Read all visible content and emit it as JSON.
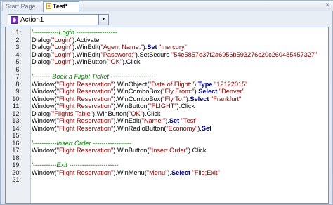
{
  "tabs": [
    {
      "label": "Start Page",
      "active": false
    },
    {
      "label": "Test*",
      "active": true
    }
  ],
  "close_glyph": "×",
  "action_selector": {
    "value": "Action1"
  },
  "editor": {
    "lines": [
      {
        "n": "1:",
        "parts": [
          {
            "t": "'------------Login -------------------",
            "c": "cm"
          }
        ]
      },
      {
        "n": "2:",
        "parts": [
          {
            "t": "Dialog(",
            "c": "pc"
          },
          {
            "t": "\"Login\"",
            "c": "st"
          },
          {
            "t": ").Activate",
            "c": "pc"
          }
        ]
      },
      {
        "n": "3:",
        "parts": [
          {
            "t": "Dialog(",
            "c": "pc"
          },
          {
            "t": "\"Login\"",
            "c": "st"
          },
          {
            "t": ").WinEdit(",
            "c": "pc"
          },
          {
            "t": "\"Agent Name:\"",
            "c": "st"
          },
          {
            "t": ").",
            "c": "pc"
          },
          {
            "t": "Set",
            "c": "kw"
          },
          {
            "t": " ",
            "c": "pc"
          },
          {
            "t": "\"mercury\"",
            "c": "st"
          }
        ]
      },
      {
        "n": "4:",
        "parts": [
          {
            "t": "Dialog(",
            "c": "pc"
          },
          {
            "t": "\"Login\"",
            "c": "st"
          },
          {
            "t": ").WinEdit(",
            "c": "pc"
          },
          {
            "t": "\"Password:\"",
            "c": "st"
          },
          {
            "t": ").SetSecure ",
            "c": "pc"
          },
          {
            "t": "\"54e5857e37f2a6956b593276c20c260485457327\"",
            "c": "st"
          }
        ]
      },
      {
        "n": "5:",
        "parts": [
          {
            "t": "Dialog(",
            "c": "pc"
          },
          {
            "t": "\"Login\"",
            "c": "st"
          },
          {
            "t": ").WinButton(",
            "c": "pc"
          },
          {
            "t": "\"OK\"",
            "c": "st"
          },
          {
            "t": ").Click",
            "c": "pc"
          }
        ]
      },
      {
        "n": "6:",
        "parts": []
      },
      {
        "n": "7:",
        "parts": [
          {
            "t": "'---------Book a Flight Ticket ---------------------",
            "c": "cm"
          }
        ]
      },
      {
        "n": "8:",
        "parts": [
          {
            "t": "Window(",
            "c": "pc"
          },
          {
            "t": "\"Flight Reservation\"",
            "c": "st"
          },
          {
            "t": ").WinObject(",
            "c": "pc"
          },
          {
            "t": "\"Date of Flight:\"",
            "c": "st"
          },
          {
            "t": ").",
            "c": "pc"
          },
          {
            "t": "Type",
            "c": "kw"
          },
          {
            "t": " ",
            "c": "pc"
          },
          {
            "t": "\"12122015\"",
            "c": "st"
          }
        ]
      },
      {
        "n": "9:",
        "parts": [
          {
            "t": "Window(",
            "c": "pc"
          },
          {
            "t": "\"Flight Reservation\"",
            "c": "st"
          },
          {
            "t": ").WinComboBox(",
            "c": "pc"
          },
          {
            "t": "\"Fly From:\"",
            "c": "st"
          },
          {
            "t": ").",
            "c": "pc"
          },
          {
            "t": "Select",
            "c": "kw"
          },
          {
            "t": " ",
            "c": "pc"
          },
          {
            "t": "\"Denver\"",
            "c": "st"
          }
        ]
      },
      {
        "n": "10:",
        "parts": [
          {
            "t": "Window(",
            "c": "pc"
          },
          {
            "t": "\"Flight Reservation\"",
            "c": "st"
          },
          {
            "t": ").WinComboBox(",
            "c": "pc"
          },
          {
            "t": "\"Fly To:\"",
            "c": "st"
          },
          {
            "t": ").",
            "c": "pc"
          },
          {
            "t": "Select",
            "c": "kw"
          },
          {
            "t": " ",
            "c": "pc"
          },
          {
            "t": "\"Frankfurt\"",
            "c": "st"
          }
        ]
      },
      {
        "n": "11:",
        "parts": [
          {
            "t": "Window(",
            "c": "pc"
          },
          {
            "t": "\"Flight Reservation\"",
            "c": "st"
          },
          {
            "t": ").WinButton(",
            "c": "pc"
          },
          {
            "t": "\"FLIGHT\"",
            "c": "st"
          },
          {
            "t": ").Click",
            "c": "pc"
          }
        ]
      },
      {
        "n": "12:",
        "parts": [
          {
            "t": "Dialog(",
            "c": "pc"
          },
          {
            "t": "\"Flights Table\"",
            "c": "st"
          },
          {
            "t": ").WinButton(",
            "c": "pc"
          },
          {
            "t": "\"OK\"",
            "c": "st"
          },
          {
            "t": ").Click",
            "c": "pc"
          }
        ]
      },
      {
        "n": "13:",
        "parts": [
          {
            "t": "Window(",
            "c": "pc"
          },
          {
            "t": "\"Flight Reservation\"",
            "c": "st"
          },
          {
            "t": ").WinEdit(",
            "c": "pc"
          },
          {
            "t": "\"Name:\"",
            "c": "st"
          },
          {
            "t": ").",
            "c": "pc"
          },
          {
            "t": "Set",
            "c": "kw"
          },
          {
            "t": " ",
            "c": "pc"
          },
          {
            "t": "\"Test\"",
            "c": "st"
          }
        ]
      },
      {
        "n": "14:",
        "parts": [
          {
            "t": "Window(",
            "c": "pc"
          },
          {
            "t": "\"Flight Reservation\"",
            "c": "st"
          },
          {
            "t": ").WinRadioButton(",
            "c": "pc"
          },
          {
            "t": "\"Economy\"",
            "c": "st"
          },
          {
            "t": ").",
            "c": "pc"
          },
          {
            "t": "Set",
            "c": "kw"
          }
        ]
      },
      {
        "n": "15:",
        "parts": []
      },
      {
        "n": "16:",
        "parts": [
          {
            "t": "'-----------Insert Order ------------------",
            "c": "cm"
          }
        ]
      },
      {
        "n": "17:",
        "parts": [
          {
            "t": "Window(",
            "c": "pc"
          },
          {
            "t": "\"Flight Reservation\"",
            "c": "st"
          },
          {
            "t": ").WinButton(",
            "c": "pc"
          },
          {
            "t": "\"Insert Order\"",
            "c": "st"
          },
          {
            "t": ").Click",
            "c": "pc"
          }
        ]
      },
      {
        "n": "18:",
        "parts": []
      },
      {
        "n": "19:",
        "parts": [
          {
            "t": "'-----------Exit -----------------------",
            "c": "cm"
          }
        ]
      },
      {
        "n": "20:",
        "parts": [
          {
            "t": "Window(",
            "c": "pc"
          },
          {
            "t": "\"Flight Reservation\"",
            "c": "st"
          },
          {
            "t": ").WinMenu(",
            "c": "pc"
          },
          {
            "t": "\"Menu\"",
            "c": "st"
          },
          {
            "t": ").",
            "c": "pc"
          },
          {
            "t": "Select",
            "c": "kw"
          },
          {
            "t": " ",
            "c": "pc"
          },
          {
            "t": "\"File;Exit\"",
            "c": "st"
          }
        ]
      },
      {
        "n": "21:",
        "parts": []
      }
    ]
  }
}
